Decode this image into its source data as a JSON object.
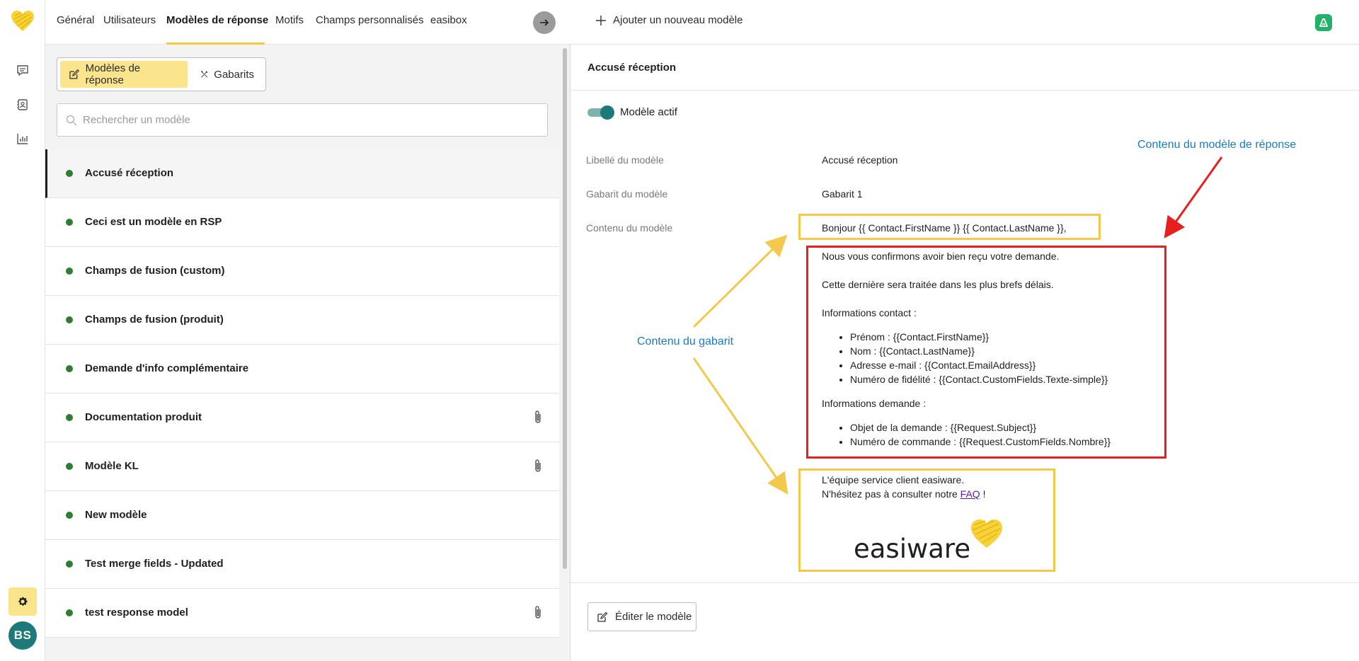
{
  "rail": {
    "avatar_initials": "BS",
    "icons": [
      "easiware-logo-icon",
      "chat-icon",
      "contacts-icon",
      "stats-icon",
      "gear-icon"
    ]
  },
  "tabs": [
    "Général",
    "Utilisateurs",
    "Modèles de réponse",
    "Motifs",
    "Champs personnalisés",
    "easibox"
  ],
  "active_tab": "Modèles de réponse",
  "segment": {
    "models_label": "Modèles de réponse",
    "templates_label": "Gabarits"
  },
  "search": {
    "placeholder": "Rechercher un modèle",
    "value": ""
  },
  "models": [
    {
      "label": "Accusé réception",
      "attachment": false
    },
    {
      "label": "Ceci est un modèle en RSP",
      "attachment": false
    },
    {
      "label": "Champs de fusion (custom)",
      "attachment": false
    },
    {
      "label": "Champs de fusion (produit)",
      "attachment": false
    },
    {
      "label": "Demande d'info complémentaire",
      "attachment": false
    },
    {
      "label": "Documentation produit",
      "attachment": true
    },
    {
      "label": "Modèle KL",
      "attachment": true
    },
    {
      "label": "New modèle",
      "attachment": false
    },
    {
      "label": "Test merge fields - Updated",
      "attachment": false
    },
    {
      "label": "test response model",
      "attachment": true
    }
  ],
  "selected_model": "Accusé réception",
  "status_color": "#2e7d32",
  "right": {
    "add_label": "Ajouter un nouveau modèle",
    "title": "Accusé réception",
    "active_label": "Modèle actif",
    "fields": {
      "label_label": "Libellé du modèle",
      "label_value": "Accusé réception",
      "template_label": "Gabarit du modèle",
      "template_value": "Gabarit 1",
      "content_label": "Contenu du modèle"
    },
    "greeting": "Bonjour {{ Contact.FirstName }} {{ Contact.LastName }},",
    "content": {
      "line1": "Nous vous confirmons avoir bien reçu votre demande.",
      "line2": "Cette dernière sera traitée dans les plus brefs délais.",
      "contact_heading": "Informations contact :",
      "contact_items": [
        "Prénom : {{Contact.FirstName}}",
        "Nom : {{Contact.LastName}}",
        "Adresse e-mail : {{Contact.EmailAddress}}",
        "Numéro de fidélité : {{Contact.CustomFields.Texte-simple}}"
      ],
      "request_heading": "Informations demande :",
      "request_items": [
        "Objet de la demande : {{Request.Subject}}",
        "Numéro de commande : {{Request.CustomFields.Nombre}}"
      ]
    },
    "signature": {
      "line1": "L'équipe service client easiware.",
      "line2_prefix": "N'hésitez pas à consulter notre",
      "link": "FAQ",
      "line2_suffix": "!",
      "brand": "easiware"
    },
    "edit_label": "Éditer le modèle"
  },
  "annotations": {
    "template_content": "Contenu du gabarit",
    "model_content": "Contenu du modèle de réponse",
    "yellow": "#f2c94c",
    "red": "#e81f1f",
    "text_color": "#1a7bc4"
  }
}
